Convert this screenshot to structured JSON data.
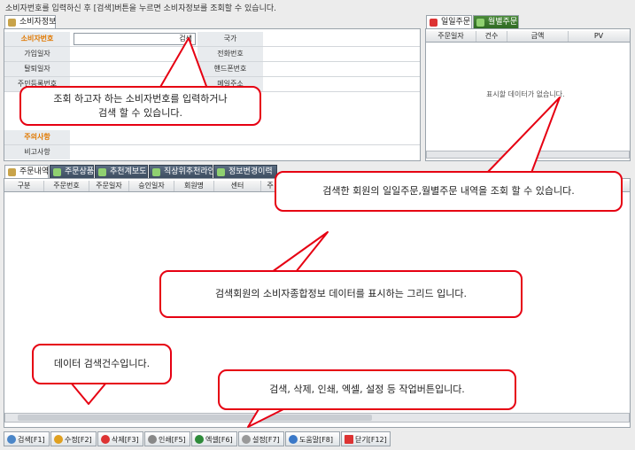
{
  "info_text": "소비자번호를 입력하신 후 [검색]버튼을 누르면 소비자정보를 조회할 수 있습니다.",
  "consumer_tab": "소비자정보",
  "search_label": "검색",
  "form": {
    "consumer_no": "소비자번호",
    "join_date": "가입일자",
    "leave_date": "탈퇴일자",
    "resident_no": "주민등록번호",
    "note": "주의사항",
    "remark": "비고사항",
    "country": "국가",
    "phone": "전화번호",
    "mobile": "핸드폰번호",
    "email": "메일주소"
  },
  "order_tabs": {
    "daily": "일일주문",
    "monthly": "월별주문"
  },
  "order_grid": {
    "headers": [
      "주문일자",
      "건수",
      "금액",
      "PV"
    ],
    "empty": "표시할 데이터가 없습니다."
  },
  "bottom_tabs": [
    "주문내역",
    "주문상품",
    "추천계보도",
    "직상위추천라인",
    "정보변경이력"
  ],
  "main_grid": {
    "headers": [
      "구분",
      "주문번호",
      "주문일자",
      "승인일자",
      "회원명",
      "센터",
      "주"
    ]
  },
  "callouts": {
    "search": "조회 하고자 하는 소비자번호를 입력하거나\n검색 할 수 있습니다.",
    "orders": "검색한 회원의 일일주문,월별주문 내역을 조회 할 수 있습니다.",
    "grid": "검색회원의 소비자종합정보 데이터를 표시하는 그리드 입니다.",
    "count": "데이터 검색건수입니다.",
    "buttons": "검색, 삭제, 인쇄, 엑셀, 설정 등 작업버튼입니다."
  },
  "toolbar": {
    "search": "검색[F1]",
    "edit": "수정[F2]",
    "delete": "삭제[F3]",
    "print": "인쇄[F5]",
    "excel": "엑셀[F6]",
    "settings": "설정[F7]",
    "help": "도움말[F8]",
    "close": "닫기[F12]"
  }
}
